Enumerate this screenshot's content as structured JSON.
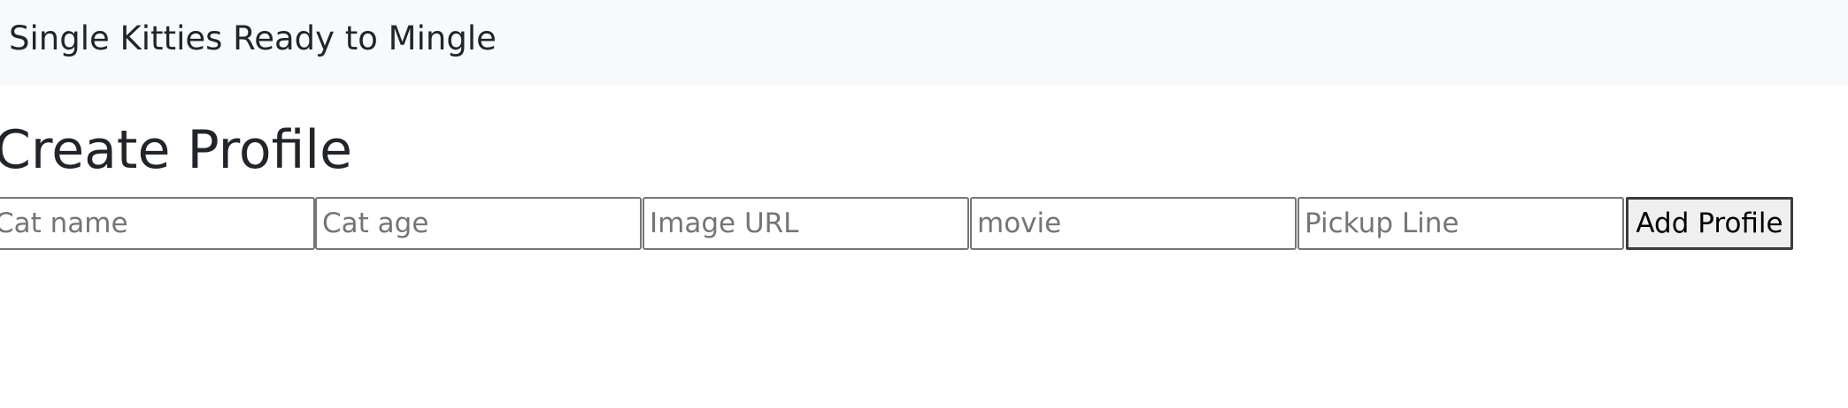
{
  "navbar": {
    "brand": "Single Kitties Ready to Mingle"
  },
  "main": {
    "title": "Create Profile",
    "form": {
      "fields": [
        {
          "placeholder": "Cat name",
          "value": ""
        },
        {
          "placeholder": "Cat age",
          "value": ""
        },
        {
          "placeholder": "Image URL",
          "value": ""
        },
        {
          "placeholder": "movie",
          "value": ""
        },
        {
          "placeholder": "Pickup Line",
          "value": ""
        }
      ],
      "submit_label": "Add Profile"
    }
  },
  "colors": {
    "navbar_bg": "#f8f9fa",
    "text": "#212529",
    "placeholder": "#757575",
    "button_bg": "#efefef"
  }
}
